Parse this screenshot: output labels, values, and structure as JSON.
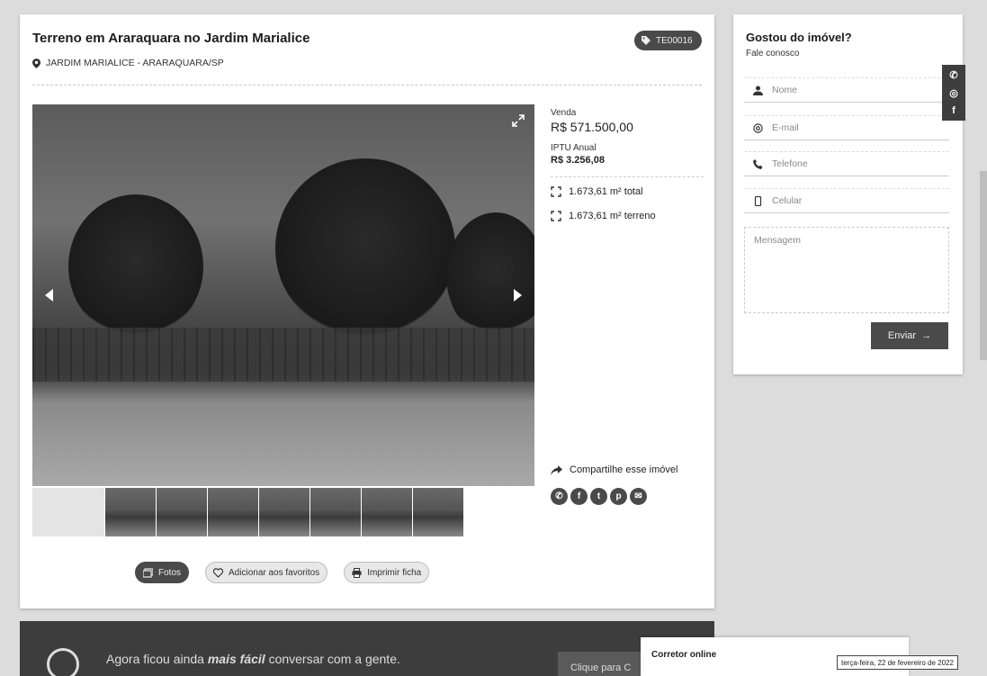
{
  "listing": {
    "title": "Terreno em Araraquara no Jardim Marialice",
    "location": "JARDIM MARIALICE - ARARAQUARA/SP",
    "code": "TE00016"
  },
  "pricing": {
    "sale_label": "Venda",
    "sale_price": "R$ 571.500,00",
    "iptu_label": "IPTU Anual",
    "iptu_value": "R$ 3.256,08"
  },
  "areas": [
    {
      "text": "1.673,61 m² total"
    },
    {
      "text": "1.673,61 m² terreno"
    }
  ],
  "share": {
    "label": "Compartilhe esse imóvel",
    "networks": [
      "whatsapp-icon",
      "facebook-icon",
      "twitter-icon",
      "pinterest-icon",
      "email-icon"
    ]
  },
  "actions": {
    "photos": "Fotos",
    "favorite": "Adicionar aos favoritos",
    "print": "Imprimir ficha"
  },
  "contact": {
    "title": "Gostou do imóvel?",
    "subtitle": "Fale conosco",
    "name_placeholder": "Nome",
    "email_placeholder": "E-mail",
    "phone_placeholder": "Telefone",
    "mobile_placeholder": "Celular",
    "message_placeholder": "Mensagem",
    "send_label": "Enviar"
  },
  "side_social": [
    "whatsapp-icon",
    "instagram-icon",
    "facebook-icon"
  ],
  "banner": {
    "text_before": "Agora ficou ainda ",
    "text_emphasis": "mais fácil",
    "text_after": " conversar com a gente.",
    "cta": "Clique para C"
  },
  "corretor": {
    "label": "Corretor online"
  },
  "date_stamp": "terça-feira, 22 de fevereiro de 2022"
}
